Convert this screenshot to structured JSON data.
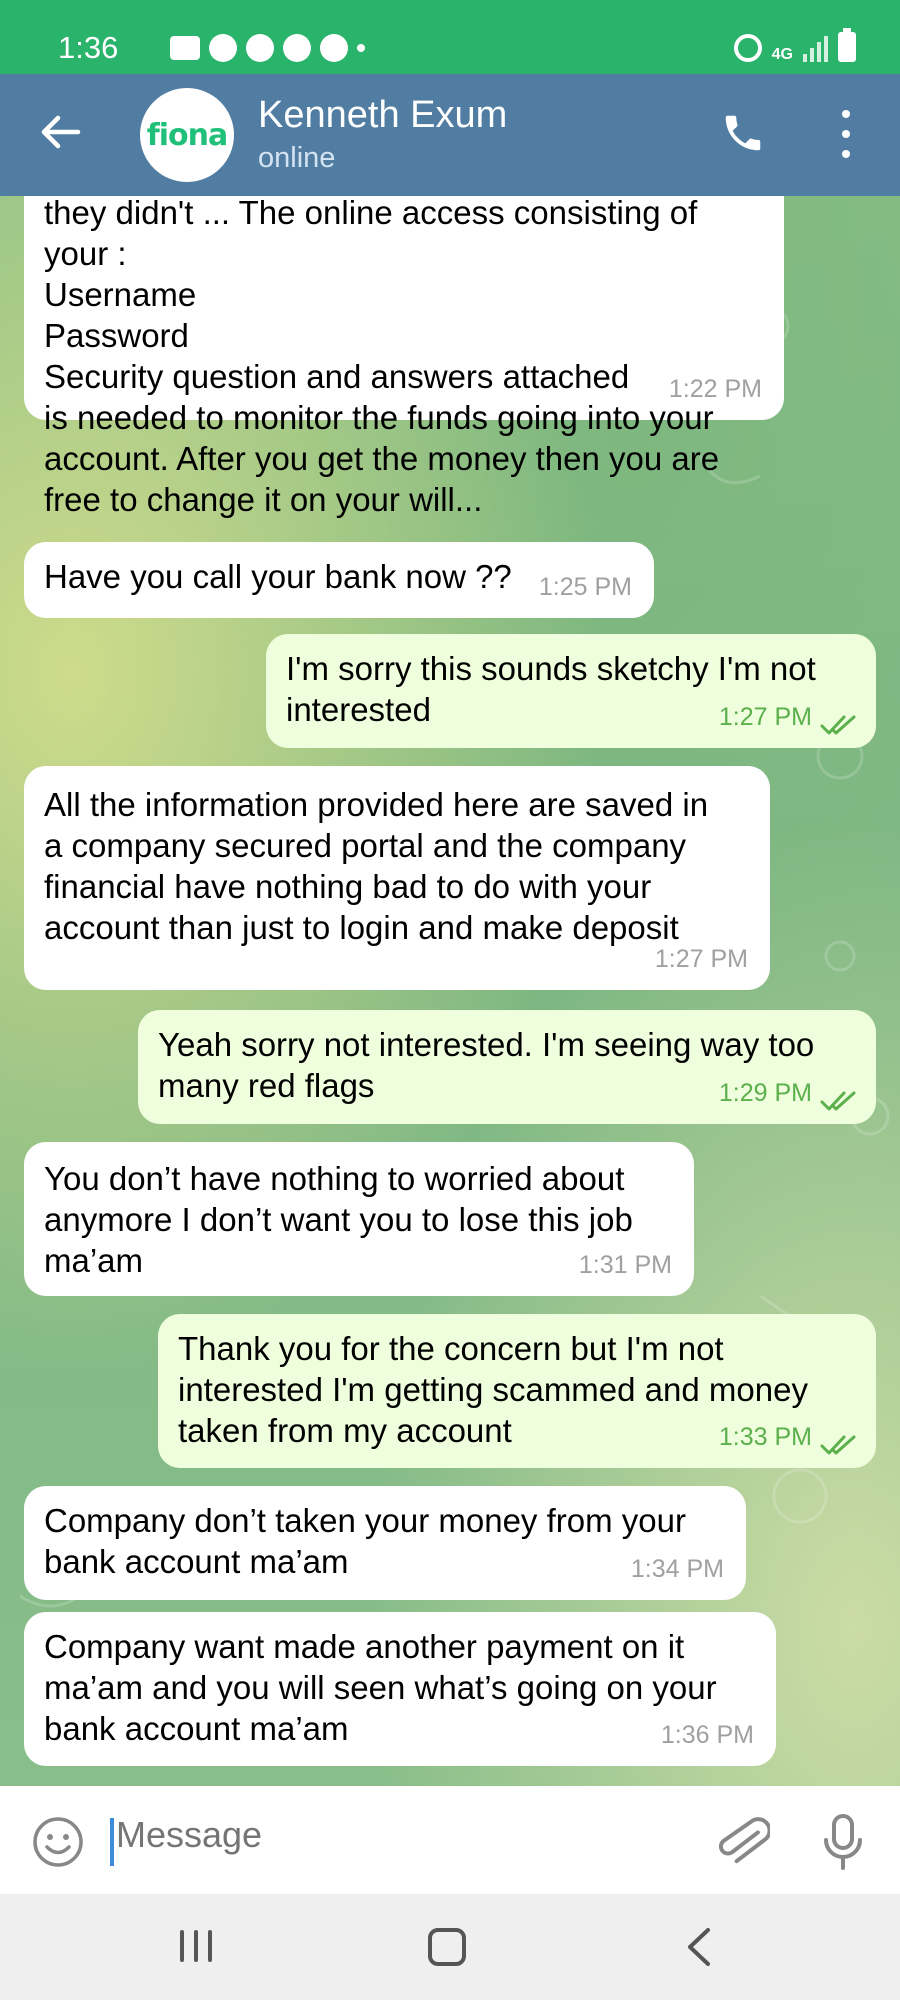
{
  "status_bar": {
    "time": "1:36",
    "network": "4G",
    "left_icons": [
      "messages-icon",
      "snapchat-icon",
      "account-icon",
      "gmail-icon",
      "chrome-icon",
      "dot-icon"
    ],
    "right_icons": [
      "alarm-icon",
      "network-icon",
      "signal-icon",
      "battery-icon"
    ]
  },
  "header": {
    "contact_name": "Kenneth Exum",
    "contact_status": "online",
    "avatar_text": "fiona",
    "colors": {
      "header_bg": "#517da2",
      "avatar_text": "#20c07a"
    }
  },
  "messages": [
    {
      "direction": "in",
      "text": "they didn't ... The online access consisting of\nyour :\nUsername\nPassword\nSecurity question and answers attached\nis needed to monitor the funds going into your\naccount. After you get the money then you are\nfree to change it on your will...",
      "time": "1:22 PM"
    },
    {
      "direction": "in",
      "text": "Have you call your bank now ??",
      "time": "1:25 PM"
    },
    {
      "direction": "out",
      "text": "I'm sorry this sounds sketchy I'm not\ninterested",
      "time": "1:27 PM",
      "read": true
    },
    {
      "direction": "in",
      "text": "All the information provided here are saved in\na company secured portal and the company\nfinancial have nothing bad to do with your\naccount than just to login and make deposit",
      "time": "1:27 PM"
    },
    {
      "direction": "out",
      "text": "Yeah sorry not interested. I'm seeing way too\nmany red flags",
      "time": "1:29 PM",
      "read": true
    },
    {
      "direction": "in",
      "text": "You don’t have nothing to worried about\nanymore I don’t want you to lose this job\nma’am",
      "time": "1:31 PM"
    },
    {
      "direction": "out",
      "text": "Thank you for the concern but I'm not\ninterested I'm getting scammed and money\ntaken from my account",
      "time": "1:33 PM",
      "read": true
    },
    {
      "direction": "in",
      "text": "Company don’t taken your money from your\nbank account ma’am",
      "time": "1:34 PM"
    },
    {
      "direction": "in",
      "text": "Company want made another payment on it\nma’am and you will seen what’s going on your\nbank account ma’am",
      "time": "1:36 PM"
    }
  ],
  "input": {
    "placeholder": "Message"
  },
  "colors": {
    "incoming_bubble": "#ffffff",
    "outgoing_bubble": "#effedd",
    "outgoing_time": "#5bb04c",
    "status_bar": "#2ab36a"
  }
}
